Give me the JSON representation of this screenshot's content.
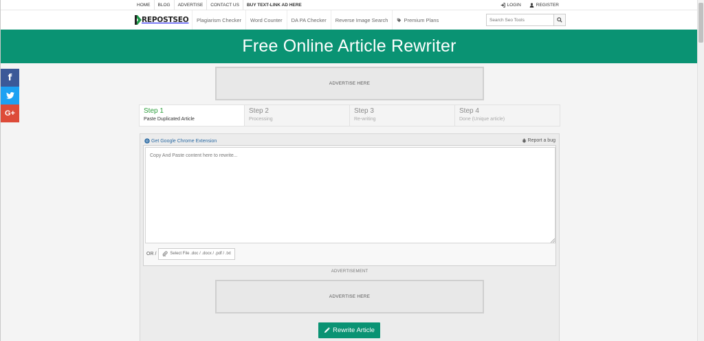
{
  "topbar": {
    "links": [
      "HOME",
      "BLOG",
      "ADVERTISE",
      "CONTACT US",
      "BUY TEXT-LINK AD HERE"
    ],
    "login": "LOGIN",
    "register": "REGISTER"
  },
  "navbar": {
    "logo_text": "REPOSTSEO",
    "links": [
      "Plagiarism Checker",
      "Word Counter",
      "DA PA Checker",
      "Reverse Image Search",
      "Premium Plans"
    ],
    "search_placeholder": "Search Seo Tools"
  },
  "hero": {
    "title": "Free Online Article Rewriter"
  },
  "social": {
    "facebook": "f",
    "googleplus": "G+"
  },
  "ads": {
    "top": "ADVERTISE HERE",
    "caption": "ADVERTISEMENT",
    "middle": "ADVERTISE HERE"
  },
  "steps": [
    {
      "num": "Step 1",
      "desc": "Paste Duplicated Article"
    },
    {
      "num": "Step 2",
      "desc": "Processing"
    },
    {
      "num": "Step 3",
      "desc": "Re-writing"
    },
    {
      "num": "Step 4",
      "desc": "Done (Unique article)"
    }
  ],
  "editor": {
    "chrome_link": "Get Google Chrome Extension",
    "report_bug": "Report a bug",
    "placeholder": "Copy And Paste content here to rewrite...",
    "or_label": "OR /",
    "file_button": "Select File .doc / .docx / .pdf / .txt"
  },
  "rewrite_button": "Rewrite Article",
  "colors": {
    "accent": "#0a9373",
    "facebook": "#3b5998",
    "twitter": "#1da1f2",
    "googleplus": "#dd4b39"
  }
}
